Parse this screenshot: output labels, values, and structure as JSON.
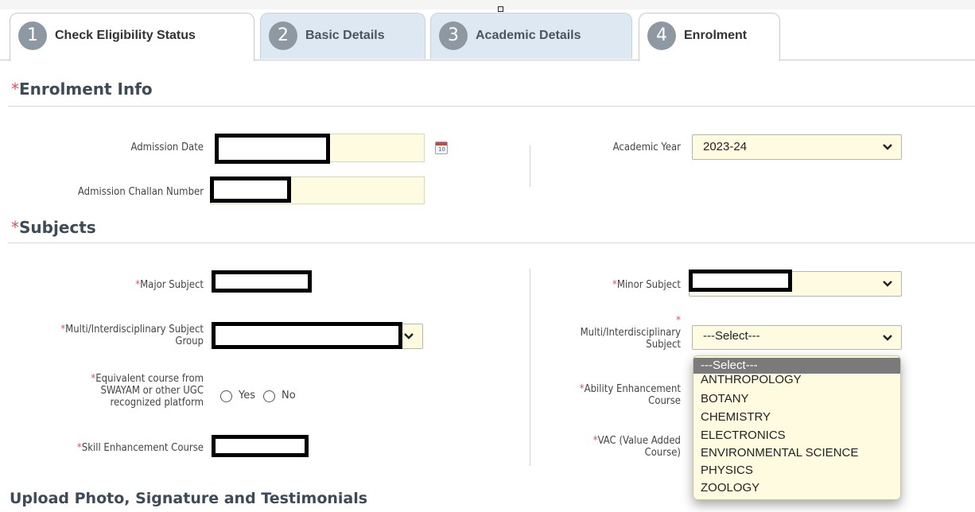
{
  "tabs": [
    {
      "number": "1",
      "label": "Check Eligibility Status"
    },
    {
      "number": "2",
      "label": "Basic Details"
    },
    {
      "number": "3",
      "label": "Academic Details"
    },
    {
      "number": "4",
      "label": "Enrolment"
    }
  ],
  "enrolment_info": {
    "title": "Enrolment Info",
    "admission_date_label": "Admission Date",
    "admission_challan_label": "Admission Challan Number",
    "calendar_icon_text": "10",
    "academic_year_label": "Academic Year",
    "academic_year_value": "2023-24"
  },
  "subjects": {
    "title": "Subjects",
    "major_subject_label": "Major Subject",
    "minor_subject_label": "Minor Subject",
    "multi_group_label_line1": "Multi/Interdisciplinary Subject",
    "multi_group_label_line2": "Group",
    "multi_subject_label_line1": "Multi/Interdisciplinary",
    "multi_subject_label_line2": "Subject",
    "multi_subject_value": "---Select---",
    "equivalent_label_line1": "Equivalent course from",
    "equivalent_label_line2": "SWAYAM or other UGC",
    "equivalent_label_line3": "recognized platform",
    "radio_yes": "Yes",
    "radio_no": "No",
    "ability_label_line1": "Ability Enhancement",
    "ability_label_line2": "Course",
    "skill_label": "Skill Enhancement Course",
    "vac_label_line1": "VAC (Value Added",
    "vac_label_line2": "Course)",
    "required_marker": "*"
  },
  "dropdown_options": [
    "---Select---",
    "ANTHROPOLOGY",
    "BOTANY",
    "CHEMISTRY",
    "ELECTRONICS",
    "ENVIRONMENTAL SCIENCE",
    "PHYSICS",
    "ZOOLOGY"
  ],
  "upload_section_title": "Upload Photo, Signature and Testimonials",
  "colors": {
    "required": "#e0505a",
    "field_background": "#fffbe0",
    "tab_inactive": "#dde8f3",
    "tab_number": "#8e98a2"
  }
}
